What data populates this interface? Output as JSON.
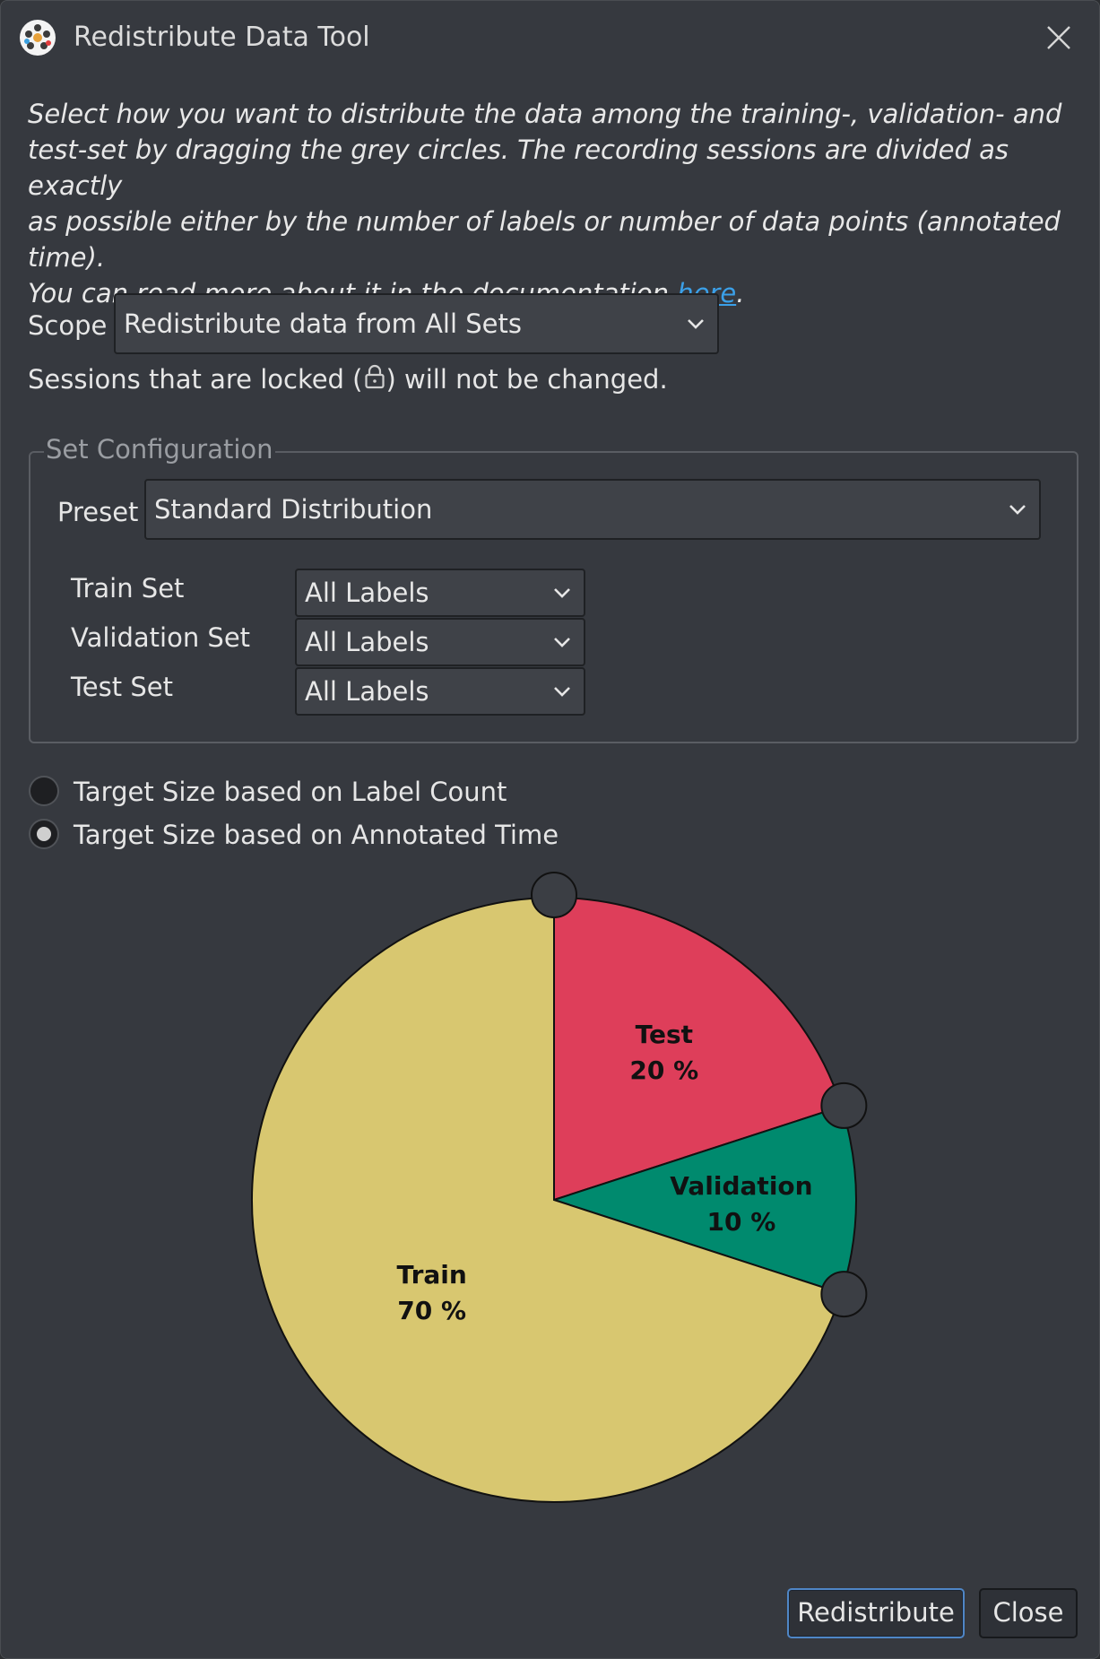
{
  "window": {
    "title": "Redistribute Data Tool"
  },
  "description": {
    "line1": "Select how you want to distribute the data among the training-, validation- and",
    "line2": "test-set by dragging the grey circles. The recording sessions are divided as exactly",
    "line3": "as possible either by the number of labels or number of data points (annotated time).",
    "line4_prefix": "You can read more about it in the documentation ",
    "link_text": "here",
    "line4_suffix": "."
  },
  "scope": {
    "label": "Scope",
    "selected": "Redistribute data from All Sets",
    "locked_note_before": "Sessions that are locked (",
    "locked_note_after": ") will not be changed."
  },
  "set_configuration": {
    "title": "Set Configuration",
    "preset_label": "Preset",
    "preset_selected": "Standard Distribution",
    "rows": [
      {
        "label": "Train Set",
        "selected": "All Labels"
      },
      {
        "label": "Validation Set",
        "selected": "All Labels"
      },
      {
        "label": "Test Set",
        "selected": "All Labels"
      }
    ]
  },
  "target_size": {
    "options": [
      {
        "label": "Target Size based on Label Count",
        "checked": false
      },
      {
        "label": "Target Size based on Annotated Time",
        "checked": true
      }
    ]
  },
  "chart_data": {
    "type": "pie",
    "start_angle_deg": 90,
    "direction": "clockwise",
    "slices": [
      {
        "name": "Test",
        "value": 20,
        "label": "20 %",
        "color": "#de3e5a"
      },
      {
        "name": "Validation",
        "value": 10,
        "label": "10 %",
        "color": "#008a6e"
      },
      {
        "name": "Train",
        "value": 70,
        "label": "70 %",
        "color": "#d8c770"
      }
    ],
    "handle_color": "#3b3e44"
  },
  "buttons": {
    "redistribute": "Redistribute",
    "close": "Close"
  },
  "colors": {
    "background": "#36393f",
    "link": "#3ba0e8",
    "accent_border": "#4f86c6"
  }
}
